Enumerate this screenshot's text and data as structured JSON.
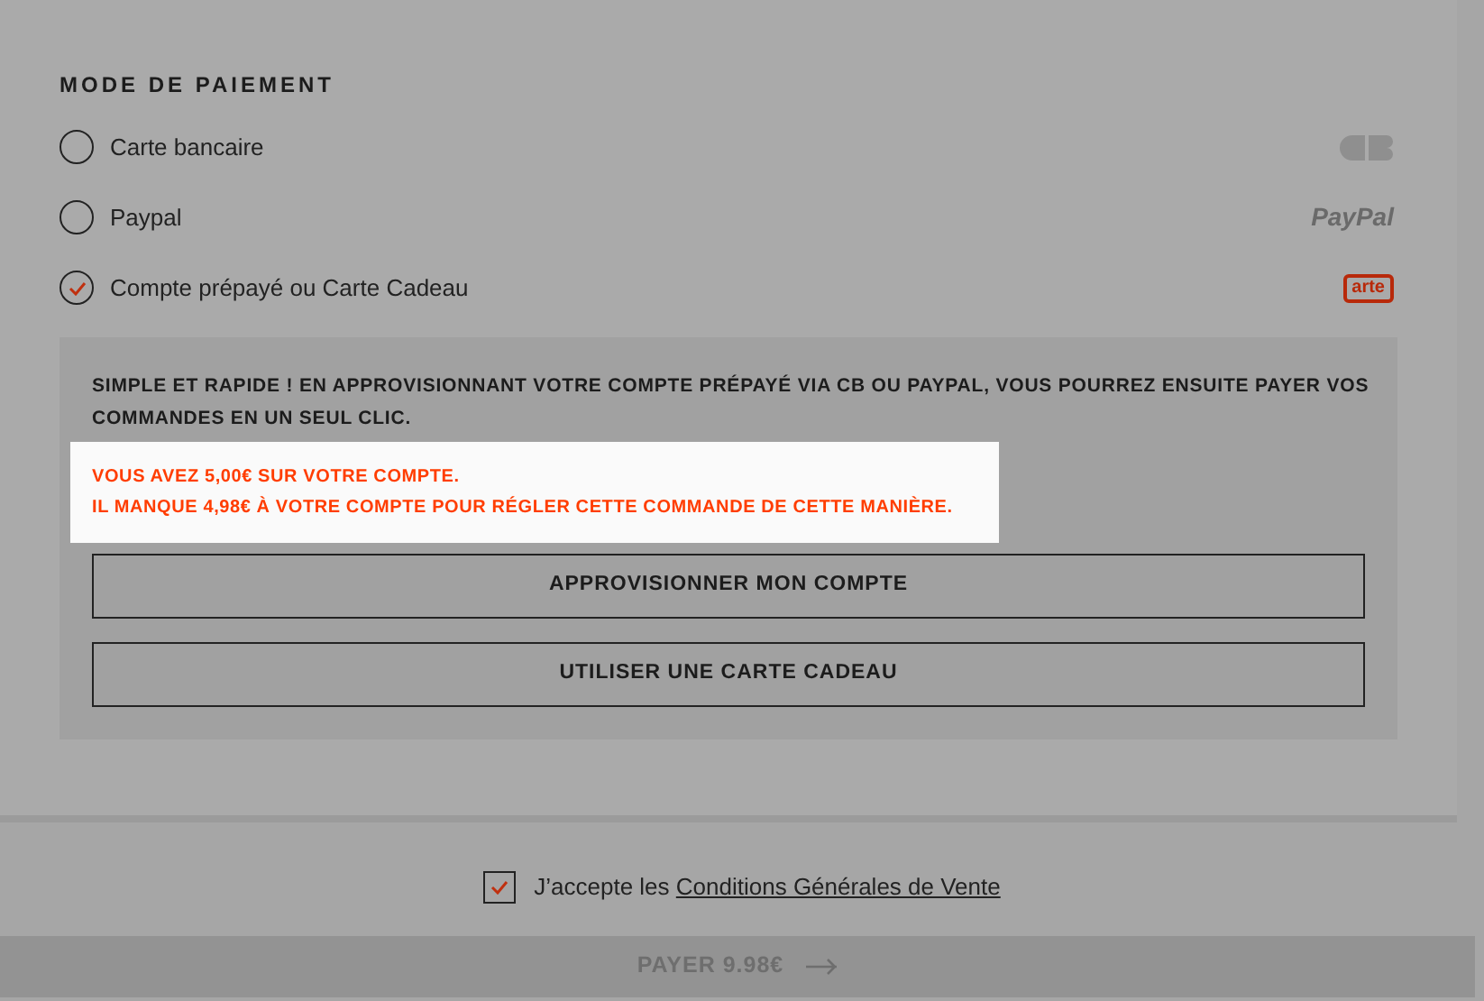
{
  "section_title": "MODE DE PAIEMENT",
  "methods": [
    {
      "label": "Carte bancaire",
      "selected": false,
      "kind": "cb"
    },
    {
      "label": "Paypal",
      "selected": false,
      "kind": "paypal",
      "logo_text": "PayPal"
    },
    {
      "label": "Compte prépayé ou Carte Cadeau",
      "selected": true,
      "kind": "arte",
      "logo_text": "arte"
    }
  ],
  "prepaid": {
    "description": "SIMPLE ET RAPIDE ! EN APPROVISIONNANT VOTRE COMPTE PRÉPAYÉ VIA CB OU PAYPAL, VOUS POURREZ ENSUITE PAYER VOS COMMANDES EN UN SEUL CLIC.",
    "alert_lines": [
      "VOUS AVEZ 5,00€ SUR VOTRE COMPTE.",
      "IL MANQUE 4,98€ À VOTRE COMPTE POUR RÉGLER CETTE COMMANDE DE CETTE MANIÈRE."
    ],
    "buttons": [
      "APPROVISIONNER MON COMPTE",
      "UTILISER UNE CARTE CADEAU"
    ]
  },
  "terms": {
    "checked": true,
    "text": "J’accepte les",
    "link": "Conditions Générales de Vente"
  },
  "pay_button": {
    "label": "PAYER 9.98€",
    "disabled": true
  }
}
